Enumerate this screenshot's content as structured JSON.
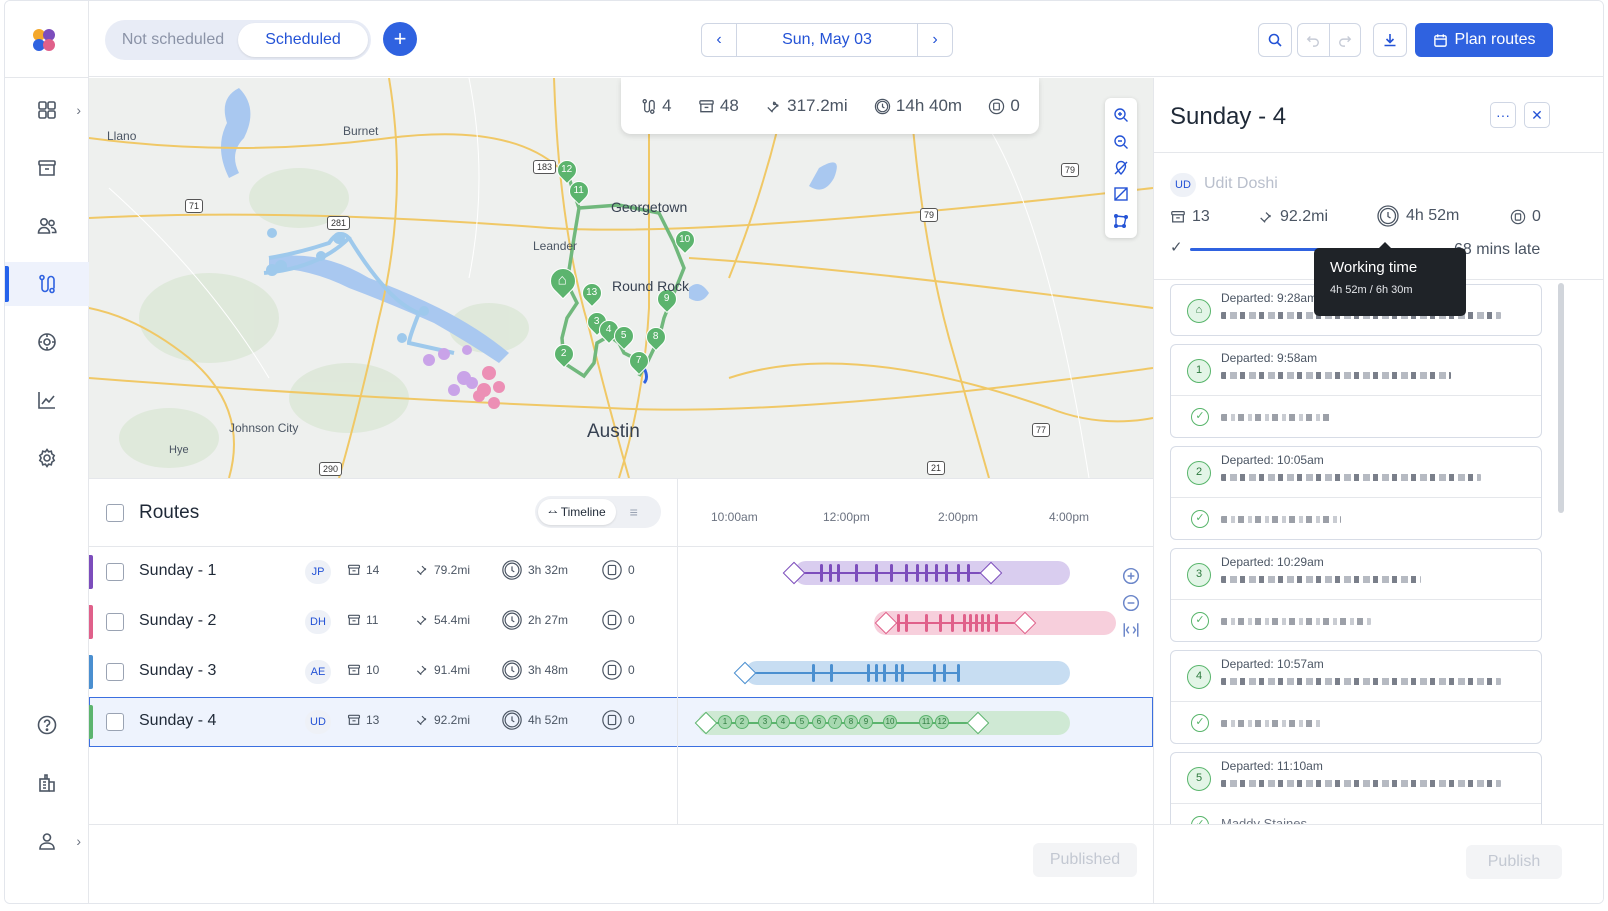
{
  "header": {
    "tabs": [
      "Not scheduled",
      "Scheduled"
    ],
    "active_tab": "Scheduled",
    "add_label": "+",
    "date": "Sun, May 03",
    "prev_label": "‹",
    "next_label": "›",
    "plan_routes_label": "Plan routes"
  },
  "sidebar": {
    "items": [
      "dashboard-icon",
      "orders-icon",
      "team-icon",
      "routes-icon",
      "tracking-icon",
      "analytics-icon",
      "settings-icon"
    ],
    "active": "routes-icon",
    "chevron": "›"
  },
  "map": {
    "stats": {
      "routes": "4",
      "stops": "48",
      "distance": "317.2mi",
      "duration": "14h 40m",
      "unassigned": "0"
    },
    "labels": {
      "llano": "Llano",
      "burnet": "Burnet",
      "leander": "Leander",
      "georgetown": "Georgetown",
      "round_rock": "Round Rock",
      "austin": "Austin",
      "johnson_city": "Johnson City",
      "hye": "Hye"
    },
    "highways": {
      "h183": "183",
      "h281": "281",
      "h71": "71",
      "h79a": "79",
      "h79b": "79",
      "h290": "290",
      "h21": "21",
      "h77": "77"
    },
    "pins": [
      "12",
      "11",
      "10",
      "13",
      "9",
      "3",
      "4",
      "5",
      "8",
      "2",
      "7"
    ]
  },
  "routes": {
    "title": "Routes",
    "view_timeline": "Timeline",
    "view_list": "≡",
    "time_ticks": [
      "10:00am",
      "12:00pm",
      "2:00pm",
      "4:00pm"
    ],
    "items": [
      {
        "name": "Sunday - 1",
        "initials": "JP",
        "stops": "14",
        "distance": "79.2mi",
        "duration": "3h 32m",
        "unassigned": "0",
        "color": "#7c4dbc",
        "light": "#d9cdef"
      },
      {
        "name": "Sunday - 2",
        "initials": "DH",
        "stops": "11",
        "distance": "54.4mi",
        "duration": "2h 27m",
        "unassigned": "0",
        "color": "#e0608a",
        "light": "#f7cfdc"
      },
      {
        "name": "Sunday - 3",
        "initials": "AE",
        "stops": "10",
        "distance": "91.4mi",
        "duration": "3h 48m",
        "unassigned": "0",
        "color": "#4a8fd0",
        "light": "#c7ddf2"
      },
      {
        "name": "Sunday - 4",
        "initials": "UD",
        "stops": "13",
        "distance": "92.2mi",
        "duration": "4h 52m",
        "unassigned": "0",
        "color": "#5cb46e",
        "light": "#cfe9d4"
      }
    ],
    "timeline_stops": [
      "1",
      "2",
      "3",
      "4",
      "5",
      "6",
      "7",
      "8",
      "9",
      "10",
      "11",
      "12"
    ],
    "published_label": "Published"
  },
  "panel": {
    "title": "Sunday - 4",
    "more_label": "···",
    "close_label": "✕",
    "driver_initials": "UD",
    "driver_name": "Udit Doshi",
    "stops": "13",
    "distance": "92.2mi",
    "duration": "4h 52m",
    "unassigned": "0",
    "check": "✓",
    "late": "68 mins late",
    "tooltip_title": "Working time",
    "tooltip_value": "4h 52m / 6h 30m",
    "stops_list": [
      {
        "badge": "⌂",
        "departed": "Departed: 9:28am",
        "has_bottom": false
      },
      {
        "badge": "1",
        "departed": "Departed: 9:58am",
        "has_bottom": true
      },
      {
        "badge": "2",
        "departed": "Departed: 10:05am",
        "has_bottom": true
      },
      {
        "badge": "3",
        "departed": "Departed: 10:29am",
        "has_bottom": true
      },
      {
        "badge": "4",
        "departed": "Departed: 10:57am",
        "has_bottom": true
      },
      {
        "badge": "5",
        "departed": "Departed: 11:10am",
        "has_bottom": true
      }
    ],
    "last_customer": "Maddy Staines",
    "publish_label": "Publish"
  },
  "colors": {
    "primary": "#2f62e0",
    "route_green": "#5cb46e",
    "water": "#a9c8f0"
  }
}
